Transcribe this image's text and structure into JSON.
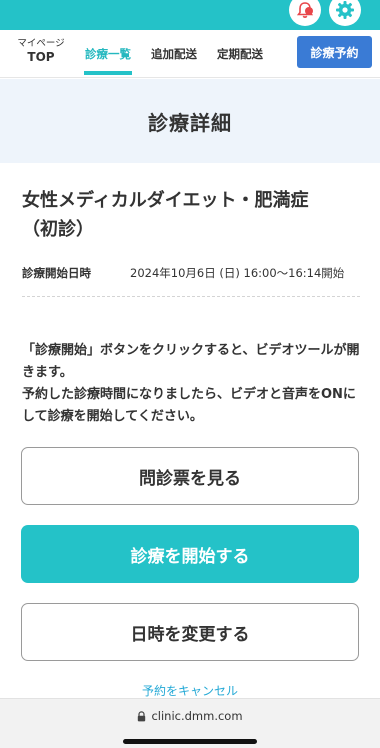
{
  "header": {
    "icons": [
      "bell-icon",
      "gear-icon"
    ],
    "accent_color": "#24c2c8"
  },
  "nav": {
    "mypage_small": "マイページ",
    "mypage_big": "TOP",
    "tabs": [
      {
        "label": "診療一覧",
        "active": true
      },
      {
        "label": "追加配送",
        "active": false
      },
      {
        "label": "定期配送",
        "active": false
      }
    ],
    "reserve_button": "診療予約",
    "reserve_color": "#3a7bd5"
  },
  "page": {
    "title": "診療詳細"
  },
  "exam": {
    "title_line1": "女性メディカルダイエット・肥満症",
    "title_line2": "（初診）",
    "date_label": "診療開始日時",
    "date_value": "2024年10月6日 (日) 16:00〜16:14開始"
  },
  "instructions": {
    "line1": "「診療開始」ボタンをクリックすると、ビデオツールが開きます。",
    "line2": "予約した診療時間になりましたら、ビデオと音声をONにして診療を開始してください。"
  },
  "buttons": {
    "questionnaire": "問診票を見る",
    "start": "診療を開始する",
    "change": "日時を変更する",
    "cancel": "予約をキャンセル"
  },
  "browser": {
    "url": "clinic.dmm.com",
    "lock_icon": "lock-icon"
  }
}
